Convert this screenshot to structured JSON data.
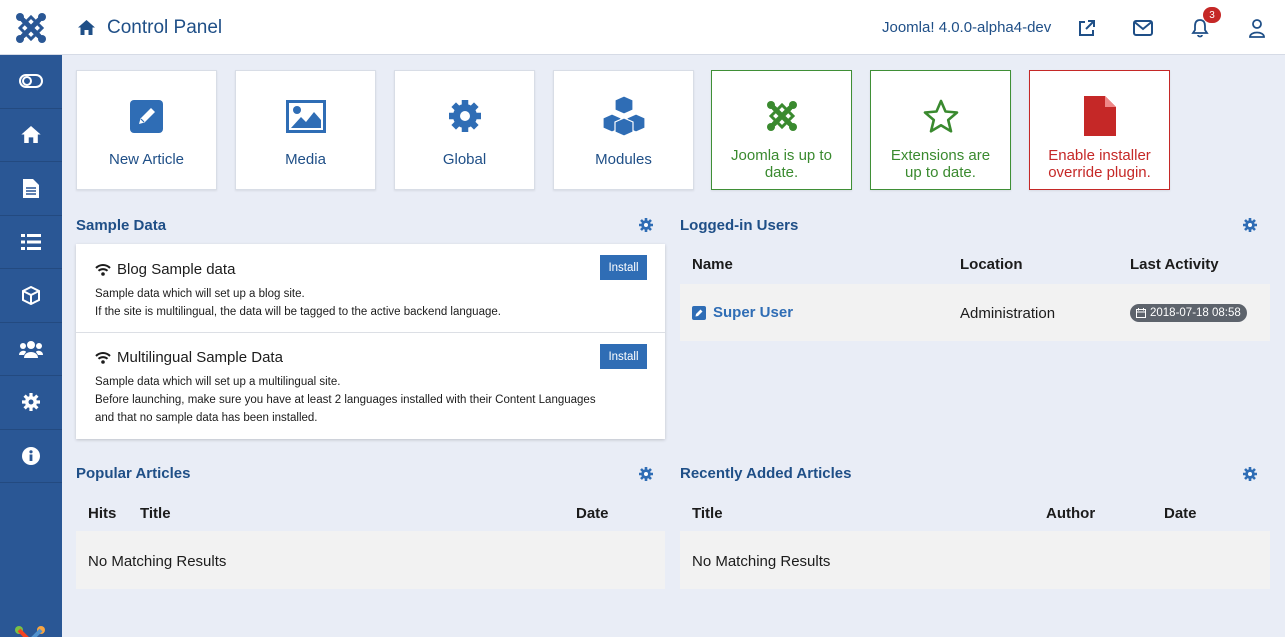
{
  "header": {
    "title": "Control Panel",
    "version": "Joomla! 4.0.0-alpha4-dev",
    "notification_count": "3"
  },
  "sidebar": {
    "items": [
      {
        "icon": "toggle-icon"
      },
      {
        "icon": "home-icon"
      },
      {
        "icon": "article-icon"
      },
      {
        "icon": "list-icon"
      },
      {
        "icon": "cube-icon"
      },
      {
        "icon": "users-icon"
      },
      {
        "icon": "gear-icon"
      },
      {
        "icon": "info-icon"
      }
    ]
  },
  "quickicons": [
    {
      "label": "New Article"
    },
    {
      "label": "Media"
    },
    {
      "label": "Global"
    },
    {
      "label": "Modules"
    },
    {
      "label": "Joomla is up to date."
    },
    {
      "label": "Extensions are up to date."
    },
    {
      "label": "Enable installer override plugin."
    }
  ],
  "sample_data": {
    "title": "Sample Data",
    "items": [
      {
        "name": "Blog Sample data",
        "button": "Install",
        "desc_lines": [
          "Sample data which will set up a blog site.",
          "If the site is multilingual, the data will be tagged to the active backend language."
        ]
      },
      {
        "name": "Multilingual Sample Data",
        "button": "Install",
        "desc_lines": [
          "Sample data which will set up a multilingual site.",
          "Before launching, make sure you have at least 2 languages installed with their Content Languages",
          "and that no sample data has been installed."
        ]
      }
    ]
  },
  "logged_in": {
    "title": "Logged-in Users",
    "columns": [
      "Name",
      "Location",
      "Last Activity"
    ],
    "rows": [
      {
        "name": "Super User",
        "location": "Administration",
        "last_activity": "2018-07-18 08:58"
      }
    ]
  },
  "popular": {
    "title": "Popular Articles",
    "columns": [
      "Hits",
      "Title",
      "Date"
    ],
    "empty": "No Matching Results"
  },
  "recent": {
    "title": "Recently Added Articles",
    "columns": [
      "Title",
      "Author",
      "Date"
    ],
    "empty": "No Matching Results"
  },
  "colors": {
    "brand_blue": "#2a5795",
    "link_blue": "#1f4f87",
    "success_green": "#3a8a2f",
    "danger_red": "#c52827"
  }
}
